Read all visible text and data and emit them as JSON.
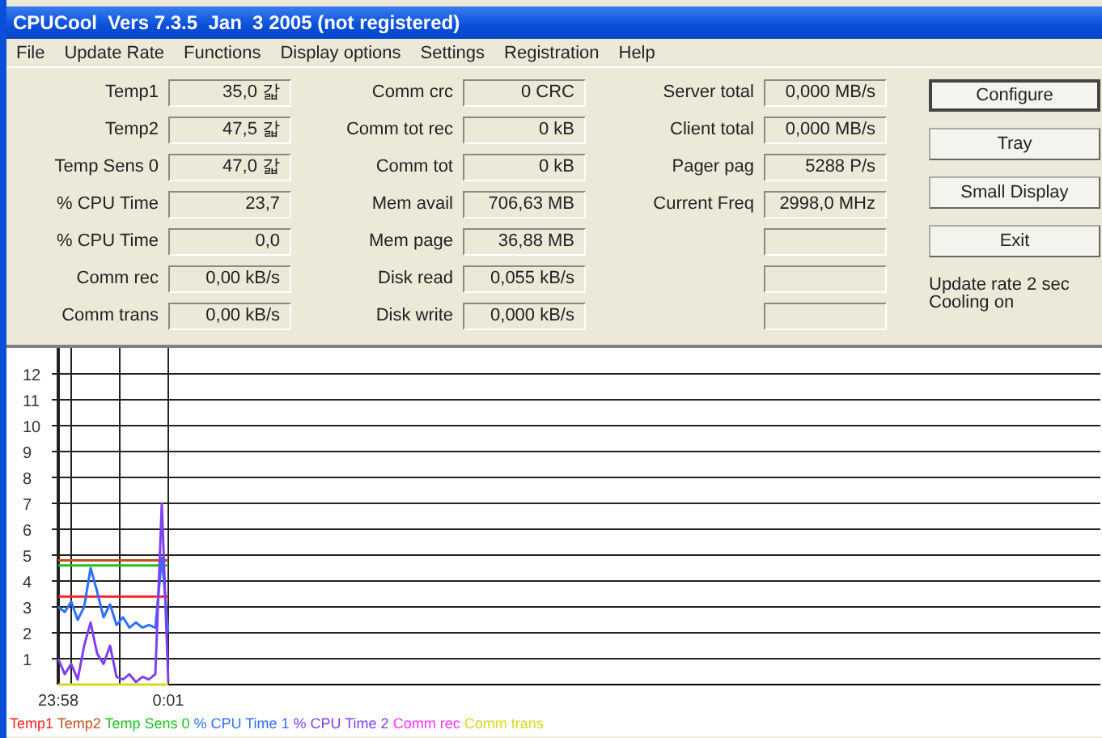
{
  "window": {
    "title": "CPUCool  Vers 7.3.5  Jan  3 2005 (not registered)"
  },
  "menu": [
    {
      "label": "File"
    },
    {
      "label": "Update Rate"
    },
    {
      "label": "Functions"
    },
    {
      "label": "Display options"
    },
    {
      "label": "Settings"
    },
    {
      "label": "Registration"
    },
    {
      "label": "Help"
    }
  ],
  "left_fields": [
    {
      "label": "Temp1",
      "value": "35,0 갋"
    },
    {
      "label": "Temp2",
      "value": "47,5 갋"
    },
    {
      "label": "Temp Sens 0",
      "value": "47,0 갋"
    },
    {
      "label": "% CPU Time",
      "value": "23,7"
    },
    {
      "label": "% CPU Time",
      "value": "0,0"
    },
    {
      "label": "Comm rec",
      "value": "0,00 kB/s"
    },
    {
      "label": "Comm trans",
      "value": "0,00 kB/s"
    }
  ],
  "middle_fields": [
    {
      "label": "Comm crc",
      "value": "0 CRC"
    },
    {
      "label": "Comm tot rec",
      "value": "0 kB"
    },
    {
      "label": "Comm tot",
      "value": "0 kB"
    },
    {
      "label": "Mem avail",
      "value": "706,63 MB"
    },
    {
      "label": "Mem page",
      "value": "36,88 MB"
    },
    {
      "label": "Disk read",
      "value": "0,055 kB/s"
    },
    {
      "label": "Disk write",
      "value": "0,000 kB/s"
    }
  ],
  "right_fields": [
    {
      "kind": "field",
      "label": "Server total",
      "value": "0,000 MB/s"
    },
    {
      "kind": "field",
      "label": "Client total",
      "value": "0,000 MB/s"
    },
    {
      "kind": "field",
      "label": "Pager pag",
      "value": "5288 P/s"
    },
    {
      "kind": "field",
      "label": "Current Freq",
      "value": "2998,0 MHz"
    },
    {
      "kind": "empty"
    },
    {
      "kind": "empty"
    },
    {
      "kind": "empty"
    }
  ],
  "buttons": [
    {
      "label": "Configure",
      "default": true
    },
    {
      "label": "Tray",
      "default": false
    },
    {
      "label": "Small Display",
      "default": false
    },
    {
      "label": "Exit",
      "default": false
    }
  ],
  "status": [
    "Update rate 2 sec",
    "Cooling on"
  ],
  "graph": {
    "chart_data": {
      "type": "line",
      "categories": [
        "23:58",
        null,
        null,
        null,
        null,
        null,
        null,
        null,
        null,
        null,
        null,
        null,
        null,
        null,
        null,
        null,
        null,
        "0:01"
      ],
      "ylim": [
        0,
        13
      ],
      "grid": true,
      "yticks": [
        1,
        2,
        3,
        4,
        5,
        6,
        7,
        8,
        9,
        10,
        11,
        12
      ],
      "series": [
        {
          "name": "Temp1",
          "color": "#ff2020",
          "values": [
            3.4,
            3.4,
            3.4,
            3.4,
            3.4,
            3.4,
            3.4,
            3.4,
            3.4,
            3.4,
            3.4,
            3.4,
            3.4,
            3.4,
            3.4,
            3.4,
            3.4,
            3.4
          ]
        },
        {
          "name": "Temp2",
          "color": "#c05020",
          "values": [
            4.8,
            4.8,
            4.8,
            4.8,
            4.8,
            4.8,
            4.8,
            4.8,
            4.8,
            4.8,
            4.8,
            4.8,
            4.8,
            4.8,
            4.8,
            4.8,
            4.8,
            4.8
          ]
        },
        {
          "name": "Temp Sens 0",
          "color": "#20c020",
          "values": [
            4.6,
            4.6,
            4.6,
            4.6,
            4.6,
            4.6,
            4.6,
            4.6,
            4.6,
            4.6,
            4.6,
            4.6,
            4.6,
            4.6,
            4.6,
            4.6,
            4.6,
            4.6
          ]
        },
        {
          "name": "% CPU Time 1",
          "color": "#3070ff",
          "values": [
            3,
            2.8,
            3.2,
            2.5,
            3,
            4.5,
            3.6,
            2.6,
            3.1,
            2.3,
            2.6,
            2.2,
            2.4,
            2.2,
            2.3,
            2.2,
            4.9,
            2
          ]
        },
        {
          "name": "% CPU Time 2",
          "color": "#8040f0",
          "values": [
            1,
            0.4,
            0.8,
            0.2,
            1.5,
            2.4,
            1.2,
            0.8,
            1.5,
            0.3,
            0.2,
            0.4,
            0.1,
            0.3,
            0.2,
            0.4,
            7,
            0.1
          ]
        },
        {
          "name": "Comm rec",
          "color": "#ff30ff",
          "values": [
            null,
            null,
            null,
            null,
            null,
            null,
            null,
            null,
            null,
            null,
            null,
            null,
            null,
            null,
            null,
            null,
            null,
            null
          ]
        },
        {
          "name": "Comm trans",
          "color": "#d8d820",
          "values": [
            0,
            0,
            0,
            0,
            0,
            0,
            0,
            0,
            0,
            0,
            0,
            0,
            0,
            0,
            0,
            0,
            0,
            0
          ]
        }
      ]
    }
  }
}
